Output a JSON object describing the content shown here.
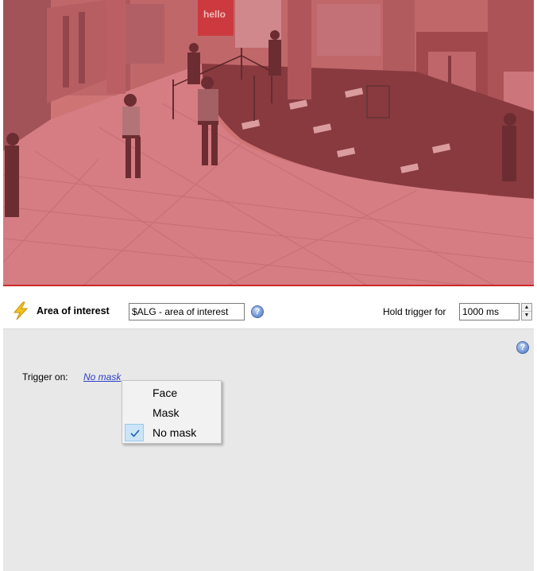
{
  "preview": {
    "signage": "hello"
  },
  "header": {
    "area_label": "Area of interest",
    "area_value": "$ALG - area of interest",
    "hold_label": "Hold trigger for",
    "hold_value": "1000 ms",
    "help_glyph": "?"
  },
  "panel": {
    "help_glyph": "?",
    "trigger_label": "Trigger on:",
    "trigger_value": "No mask"
  },
  "menu": {
    "items": [
      {
        "label": "Face",
        "checked": false
      },
      {
        "label": "Mask",
        "checked": false
      },
      {
        "label": "No mask",
        "checked": true
      }
    ]
  },
  "colors": {
    "overlay": "#e63c3c",
    "link": "#2b3fc7",
    "panel_bg": "#e8e8e8",
    "menu_check_bg": "#cce4f7",
    "bolt": "#f2c21b"
  },
  "icons": {
    "bolt": "lightning-bolt-icon",
    "help": "help-icon",
    "check": "check-icon",
    "spin_up": "spin-up-arrow-icon",
    "spin_down": "spin-down-arrow-icon"
  }
}
